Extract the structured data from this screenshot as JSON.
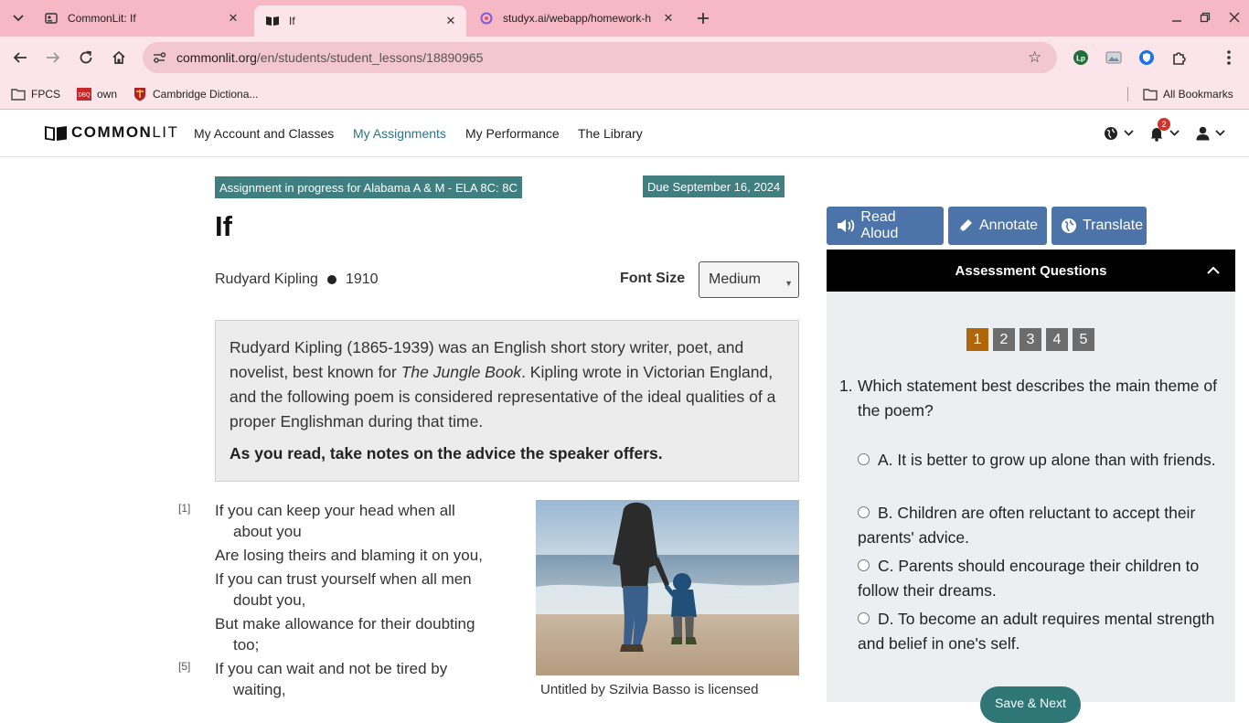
{
  "browser": {
    "tabs": [
      {
        "title": "CommonLit: If",
        "active": false
      },
      {
        "title": "If",
        "active": true
      },
      {
        "title": "studyx.ai/webapp/homework-h",
        "active": false
      }
    ],
    "url_domain": "commonlit.org",
    "url_path": "/en/students/student_lessons/18890965",
    "bookmarks": [
      "FPCS",
      "own",
      "Cambridge Dictiona..."
    ],
    "all_bookmarks": "All Bookmarks"
  },
  "header": {
    "logo_common": "COMMON",
    "logo_lit": "LIT",
    "nav": [
      "My Account and Classes",
      "My Assignments",
      "My Performance",
      "The Library"
    ],
    "notification_count": "2"
  },
  "lesson": {
    "assignment_badge": "Assignment in progress for Alabama A & M - ELA 8C: 8C",
    "due_badge": "Due September 16, 2024",
    "title": "If",
    "author": "Rudyard Kipling",
    "year": "1910",
    "font_size_label": "Font Size",
    "font_size_value": "Medium",
    "intro_1": "Rudyard Kipling (1865-1939) was an English short story writer, poet, and novelist, best known for ",
    "intro_italic": "The Jungle Book",
    "intro_2": ". Kipling wrote in Victorian England, and the following poem is considered representative of the ideal qualities of a proper Englishman during that time.",
    "intro_bold": "As you read, take notes on the advice the speaker offers.",
    "poem": [
      {
        "num": "[1]",
        "line": "If you can keep your head when all",
        "cont": "about you"
      },
      {
        "num": "",
        "line": "Are losing theirs and blaming it on you,",
        "cont": ""
      },
      {
        "num": "",
        "line": "If you can trust yourself when all men",
        "cont": "doubt you,"
      },
      {
        "num": "",
        "line": "But make allowance for their doubting",
        "cont": "too;"
      },
      {
        "num": "[5]",
        "line": "If you can wait and not be tired by",
        "cont": "waiting,"
      }
    ],
    "caption": "Untitled by Szilvia Basso is licensed"
  },
  "tools": {
    "read_aloud": "Read Aloud",
    "annotate": "Annotate",
    "translate": "Translate"
  },
  "assessment": {
    "header": "Assessment Questions",
    "question_numbers": [
      "1",
      "2",
      "3",
      "4",
      "5"
    ],
    "current_question": "1",
    "question_num": "1.",
    "question_text": "Which statement best describes the main theme of the poem?",
    "options": [
      "A. It is better to grow up alone than with friends.",
      "B. Children are often reluctant to accept their parents' advice.",
      "C. Parents should encourage their children to follow their dreams.",
      "D. To become an adult requires mental strength and belief in one's self."
    ],
    "save_next": "Save & Next"
  }
}
